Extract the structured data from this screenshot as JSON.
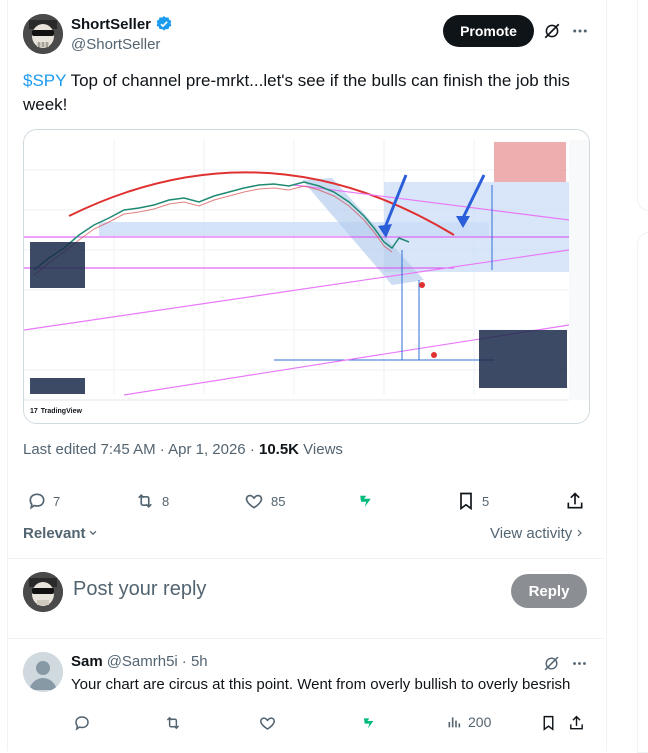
{
  "post": {
    "author_name": "ShortSeller",
    "author_handle": "@ShortSeller",
    "promote_label": "Promote",
    "text_cashtag": "$SPY",
    "text_body": " Top of channel pre-mrkt...let's see if the bulls can finish the job this week!",
    "edited_label": "Last edited 7:45 AM · Apr 1, 2026 · ",
    "views_count": "10.5K",
    "views_label": " Views"
  },
  "actions": {
    "replies": "7",
    "reposts": "8",
    "likes": "85",
    "bookmarks": "5"
  },
  "thread": {
    "sort_label": "Relevant",
    "view_activity": "View activity",
    "reply_placeholder": "Post your reply",
    "reply_button": "Reply"
  },
  "reply": {
    "author_name": "Sam",
    "author_handle": "@Samrh5i",
    "time": "· 5h",
    "text": "Your chart are circus at this point. Went from overly bullish to overly besrish",
    "views": "200"
  },
  "chart_footer": {
    "brand": "TradingView"
  },
  "colors": {
    "accent": "#1d9bf0",
    "verified": "#1d9bf0",
    "grok": "#00ba7c"
  }
}
